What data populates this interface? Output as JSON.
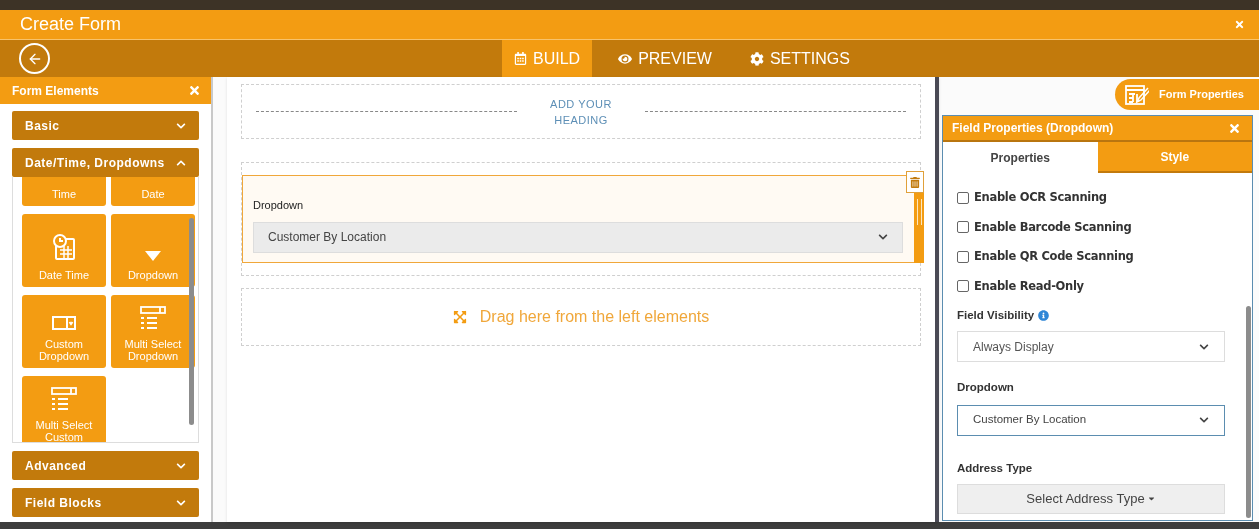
{
  "window": {
    "title": "Create Form"
  },
  "nav_tabs": [
    {
      "kind": "build",
      "label": "BUILD",
      "selected": true
    },
    {
      "kind": "preview",
      "label": "PREVIEW",
      "selected": false
    },
    {
      "kind": "settings",
      "label": "SETTINGS",
      "selected": false
    }
  ],
  "elements_panel": {
    "title": "Form Elements",
    "sections": [
      {
        "label": "Basic",
        "expanded": false
      },
      {
        "label": "Date/Time, Dropdowns",
        "expanded": true,
        "items": [
          {
            "kind": "none",
            "label": "Time"
          },
          {
            "kind": "none",
            "label": "Date"
          },
          {
            "kind": "datetime",
            "label": "Date Time"
          },
          {
            "kind": "dropdown",
            "label": "Dropdown"
          },
          {
            "kind": "custom",
            "label": "Custom Dropdown"
          },
          {
            "kind": "multi",
            "label": "Multi Select Dropdown"
          },
          {
            "kind": "multi",
            "label": "Multi Select Custom"
          }
        ]
      },
      {
        "label": "Advanced",
        "expanded": false
      },
      {
        "label": "Field Blocks",
        "expanded": false
      }
    ]
  },
  "canvas": {
    "heading": "ADD YOUR HEADING",
    "fields": [
      {
        "label": "Dropdown",
        "value": "Customer By Location",
        "selected": true
      }
    ],
    "drop_zone": "Drag here from the left elements"
  },
  "form_properties_button": "Form Properties",
  "field_properties": {
    "title": "Field Properties (Dropdown)",
    "tabs": [
      {
        "label": "Properties",
        "selected": true
      },
      {
        "label": "Style",
        "selected": false
      }
    ],
    "checkboxes": [
      {
        "label": "Enable OCR Scanning",
        "checked": false
      },
      {
        "label": "Enable Barcode Scanning",
        "checked": false
      },
      {
        "label": "Enable QR Code Scanning",
        "checked": false
      },
      {
        "label": "Enable Read-Only",
        "checked": false
      }
    ],
    "field_visibility": {
      "label": "Field Visibility",
      "value": "Always Display"
    },
    "dropdown": {
      "label": "Dropdown",
      "value": "Customer By Location"
    },
    "address_type": {
      "label": "Address Type",
      "button": "Select Address Type"
    }
  }
}
